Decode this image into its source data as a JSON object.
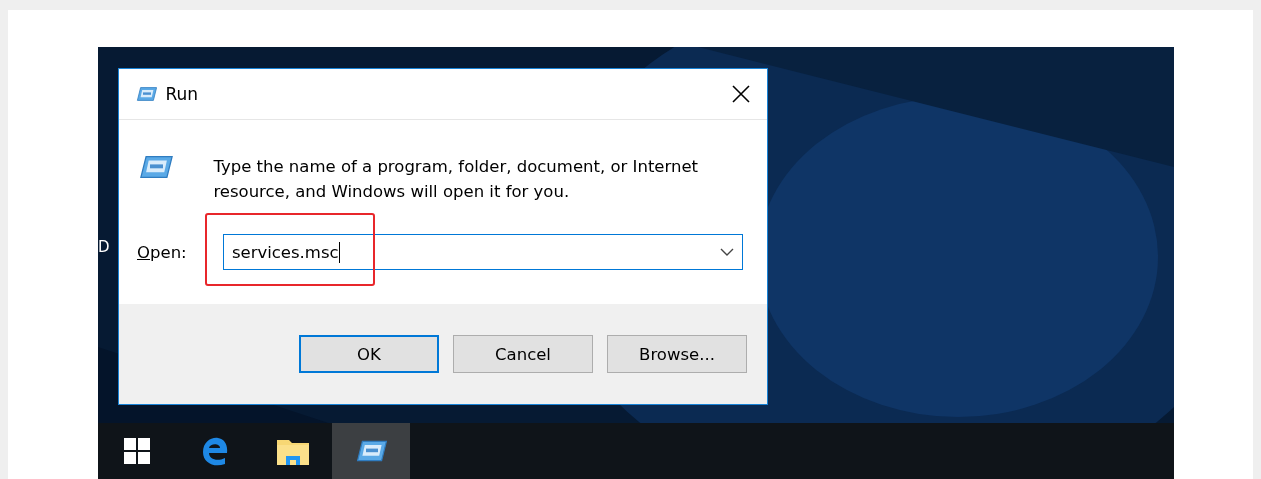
{
  "desktop": {
    "icon_labels": [
      "D"
    ]
  },
  "window": {
    "title": "Run",
    "message": "Type the name of a program, folder, document, or Internet resource, and Windows will open it for you.",
    "open_label": "Open:",
    "open_field": {
      "value": "services.msc",
      "focused": true
    },
    "buttons": [
      {
        "label": "OK",
        "default": true
      },
      {
        "label": "Cancel",
        "default": false
      },
      {
        "label": "Browse...",
        "default": false
      }
    ]
  },
  "annotation": {
    "kind": "highlight-box"
  },
  "taskbar": {
    "items": [
      {
        "kind": "start",
        "selected": false
      },
      {
        "kind": "edge",
        "selected": false
      },
      {
        "kind": "explorer",
        "selected": false
      },
      {
        "kind": "run",
        "selected": true
      }
    ]
  }
}
